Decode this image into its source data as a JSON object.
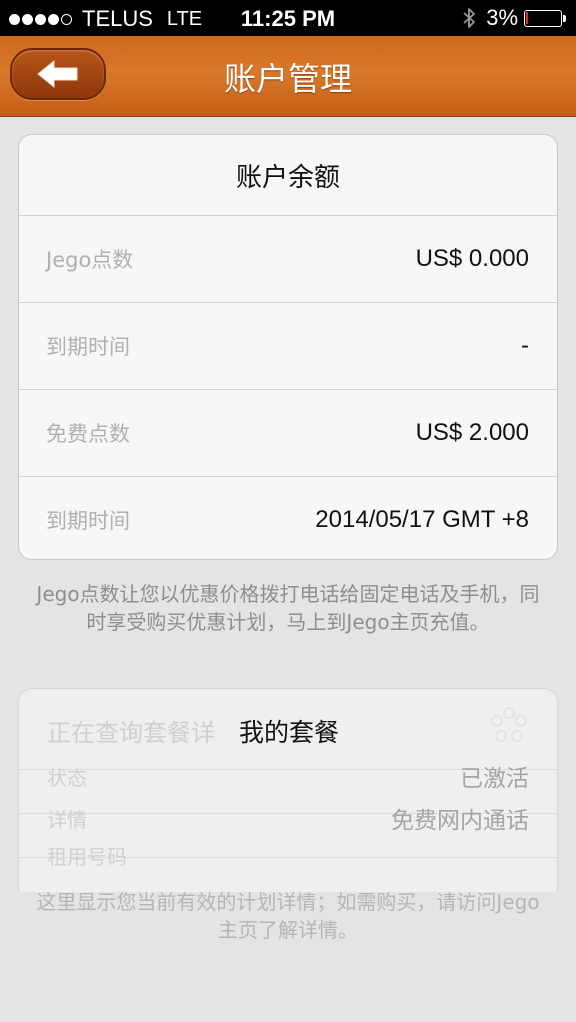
{
  "status_bar": {
    "carrier": "TELUS",
    "network": "LTE",
    "time": "11:25 PM",
    "battery_percent": "3%",
    "signal_bars_filled": 4,
    "signal_bars_total": 5
  },
  "nav": {
    "title": "账户管理",
    "back_icon": "back-arrow-icon"
  },
  "balance": {
    "header": "账户余额",
    "rows": [
      {
        "label": "Jego点数",
        "value": "US$ 0.000"
      },
      {
        "label": "到期时间",
        "value": "-"
      },
      {
        "label": "免费点数",
        "value": "US$ 2.000"
      },
      {
        "label": "到期时间",
        "value": "2014/05/17 GMT +8"
      }
    ],
    "note": "Jego点数让您以优惠价格拨打电话给固定电话及手机，同时享受购买优惠计划，马上到Jego主页充值。"
  },
  "plan": {
    "querying_text": "正在查询套餐详",
    "title": "我的套餐",
    "rows": [
      {
        "label": "状态",
        "value": "已激活"
      },
      {
        "label": "详情",
        "value": "免费网内通话"
      },
      {
        "label": "租用号码",
        "value": ""
      }
    ],
    "note": "这里显示您当前有效的计划详情；如需购买，请访问Jego主页了解详情。"
  },
  "colors": {
    "nav_orange": "#d9782a",
    "back_button": "#a4461a",
    "page_background": "#e4e4e4"
  }
}
